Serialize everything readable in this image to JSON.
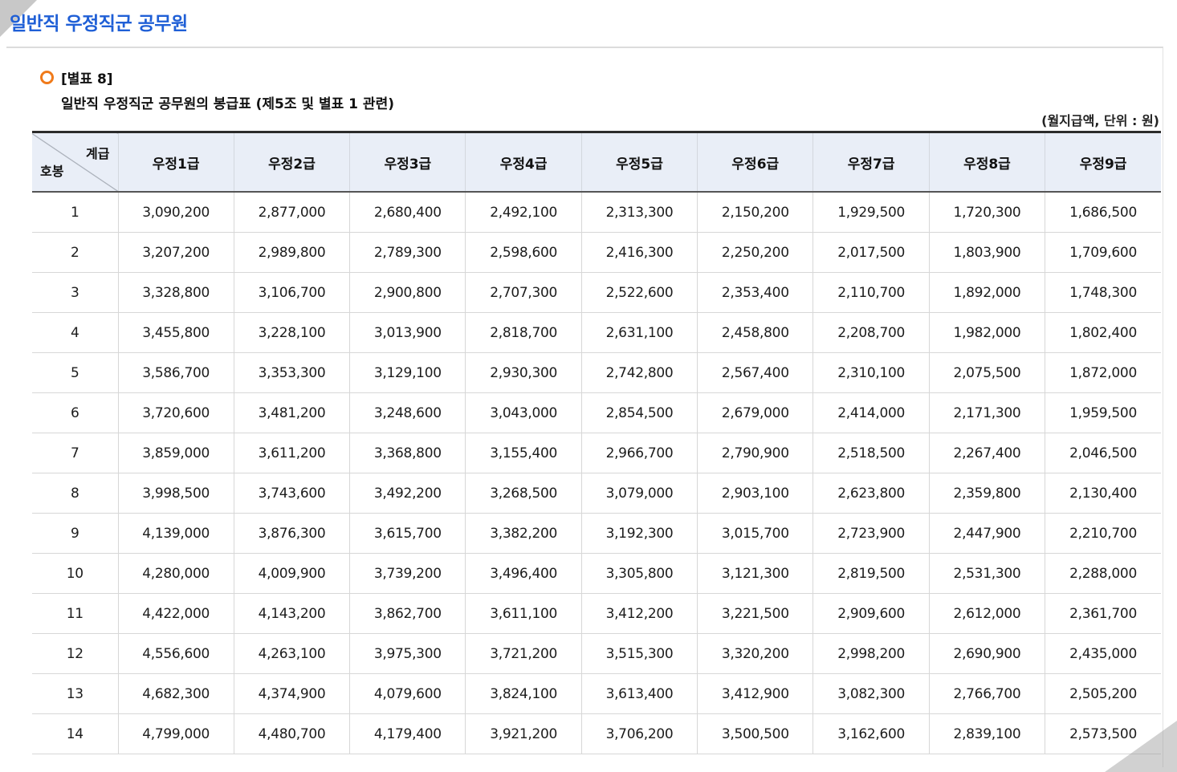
{
  "page_title": "일반직 우정직군 공무원",
  "caption": {
    "table_no": "[별표 8]",
    "title": "일반직 우정직군 공무원의 봉급표 (제5조 및 별표 1 관련)"
  },
  "unit_note": "(월지급액, 단위 : 원)",
  "table": {
    "corner_top": "계급",
    "corner_bottom": "호봉",
    "headers": [
      "우정1급",
      "우정2급",
      "우정3급",
      "우정4급",
      "우정5급",
      "우정6급",
      "우정7급",
      "우정8급",
      "우정9급"
    ],
    "rows": [
      [
        "1",
        "3,090,200",
        "2,877,000",
        "2,680,400",
        "2,492,100",
        "2,313,300",
        "2,150,200",
        "1,929,500",
        "1,720,300",
        "1,686,500"
      ],
      [
        "2",
        "3,207,200",
        "2,989,800",
        "2,789,300",
        "2,598,600",
        "2,416,300",
        "2,250,200",
        "2,017,500",
        "1,803,900",
        "1,709,600"
      ],
      [
        "3",
        "3,328,800",
        "3,106,700",
        "2,900,800",
        "2,707,300",
        "2,522,600",
        "2,353,400",
        "2,110,700",
        "1,892,000",
        "1,748,300"
      ],
      [
        "4",
        "3,455,800",
        "3,228,100",
        "3,013,900",
        "2,818,700",
        "2,631,100",
        "2,458,800",
        "2,208,700",
        "1,982,000",
        "1,802,400"
      ],
      [
        "5",
        "3,586,700",
        "3,353,300",
        "3,129,100",
        "2,930,300",
        "2,742,800",
        "2,567,400",
        "2,310,100",
        "2,075,500",
        "1,872,000"
      ],
      [
        "6",
        "3,720,600",
        "3,481,200",
        "3,248,600",
        "3,043,000",
        "2,854,500",
        "2,679,000",
        "2,414,000",
        "2,171,300",
        "1,959,500"
      ],
      [
        "7",
        "3,859,000",
        "3,611,200",
        "3,368,800",
        "3,155,400",
        "2,966,700",
        "2,790,900",
        "2,518,500",
        "2,267,400",
        "2,046,500"
      ],
      [
        "8",
        "3,998,500",
        "3,743,600",
        "3,492,200",
        "3,268,500",
        "3,079,000",
        "2,903,100",
        "2,623,800",
        "2,359,800",
        "2,130,400"
      ],
      [
        "9",
        "4,139,000",
        "3,876,300",
        "3,615,700",
        "3,382,200",
        "3,192,300",
        "3,015,700",
        "2,723,900",
        "2,447,900",
        "2,210,700"
      ],
      [
        "10",
        "4,280,000",
        "4,009,900",
        "3,739,200",
        "3,496,400",
        "3,305,800",
        "3,121,300",
        "2,819,500",
        "2,531,300",
        "2,288,000"
      ],
      [
        "11",
        "4,422,000",
        "4,143,200",
        "3,862,700",
        "3,611,100",
        "3,412,200",
        "3,221,500",
        "2,909,600",
        "2,612,000",
        "2,361,700"
      ],
      [
        "12",
        "4,556,600",
        "4,263,100",
        "3,975,300",
        "3,721,200",
        "3,515,300",
        "3,320,200",
        "2,998,200",
        "2,690,900",
        "2,435,000"
      ],
      [
        "13",
        "4,682,300",
        "4,374,900",
        "4,079,600",
        "3,824,100",
        "3,613,400",
        "3,412,900",
        "3,082,300",
        "2,766,700",
        "2,505,200"
      ],
      [
        "14",
        "4,799,000",
        "4,480,700",
        "4,179,400",
        "3,921,200",
        "3,706,200",
        "3,500,500",
        "3,162,600",
        "2,839,100",
        "2,573,500"
      ]
    ]
  },
  "colors": {
    "title_blue": "#1f5fd6",
    "bullet_orange": "#f07a1a",
    "header_bg": "#e9eef7"
  }
}
